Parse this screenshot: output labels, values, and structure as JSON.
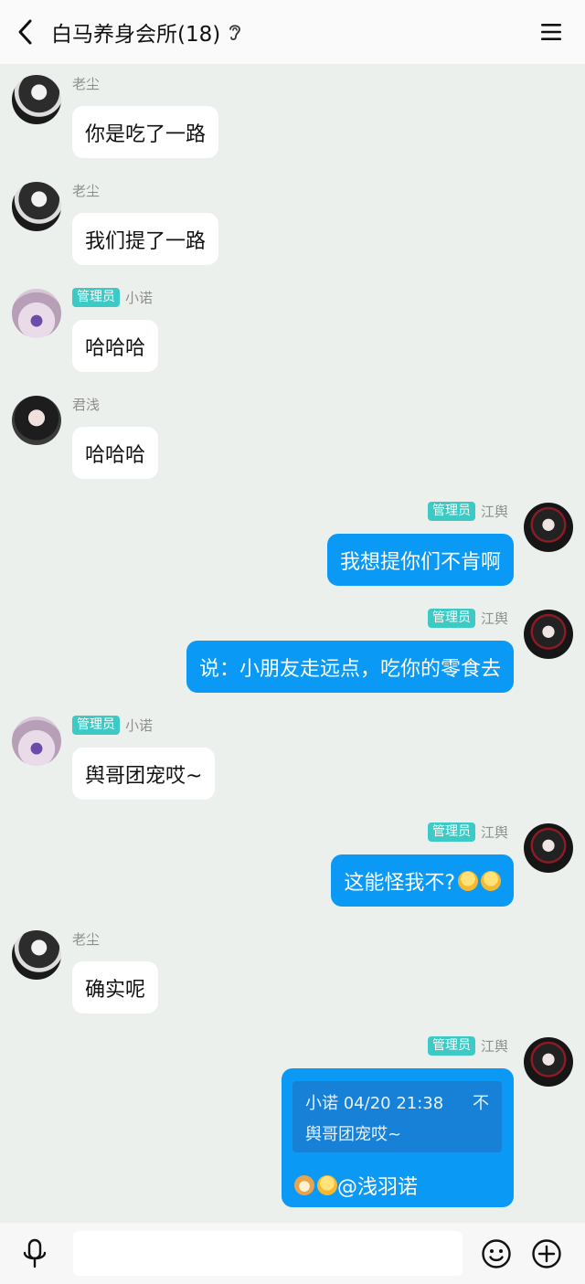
{
  "header": {
    "title": "白马养身会所(18)"
  },
  "admin_badge": "管理员",
  "messages": [
    {
      "side": "left",
      "sender": "老尘",
      "avatar": "laochen-avatar",
      "text": "你是吃了一路"
    },
    {
      "side": "left",
      "sender": "老尘",
      "avatar": "laochen-avatar",
      "text": "我们提了一路"
    },
    {
      "side": "left",
      "sender": "小诺",
      "admin": true,
      "avatar": "xiaonuo-avatar",
      "text": "哈哈哈"
    },
    {
      "side": "left",
      "sender": "君浅",
      "avatar": "junqian-avatar",
      "text": "哈哈哈"
    },
    {
      "side": "right",
      "sender": "江舆",
      "admin": true,
      "avatar": "jiangyu-avatar",
      "text": "我想提你们不肯啊"
    },
    {
      "side": "right",
      "sender": "江舆",
      "admin": true,
      "avatar": "jiangyu-avatar",
      "text": "说：小朋友走远点，吃你的零食去"
    },
    {
      "side": "left",
      "sender": "小诺",
      "admin": true,
      "avatar": "xiaonuo-avatar",
      "text": "舆哥团宠哎~"
    },
    {
      "side": "right",
      "sender": "江舆",
      "admin": true,
      "avatar": "jiangyu-avatar",
      "text": "这能怪我不?",
      "emojis": [
        "hugging-emoji",
        "hugging-emoji"
      ]
    },
    {
      "side": "left",
      "sender": "老尘",
      "avatar": "laochen-avatar",
      "text": "确实呢"
    },
    {
      "side": "right",
      "sender": "江舆",
      "admin": true,
      "avatar": "jiangyu-avatar",
      "quote": {
        "header": "小诺 04/20 21:38",
        "text": "舆哥团宠哎~",
        "close": "不"
      },
      "emojis": [
        "dog-emoji",
        "hugging-emoji"
      ],
      "text": "@浅羽诺"
    }
  ],
  "input": {
    "placeholder": ""
  },
  "icons": {
    "back": "back-arrow-icon",
    "ear": "ear-icon",
    "menu": "menu-icon",
    "mic": "microphone-icon",
    "emoji": "emoji-icon",
    "plus": "plus-icon"
  },
  "colors": {
    "self_bubble": "#0a99f5",
    "other_bubble": "#ffffff",
    "admin_badge": "#3dc9c4",
    "background": "#ecf0ed"
  }
}
